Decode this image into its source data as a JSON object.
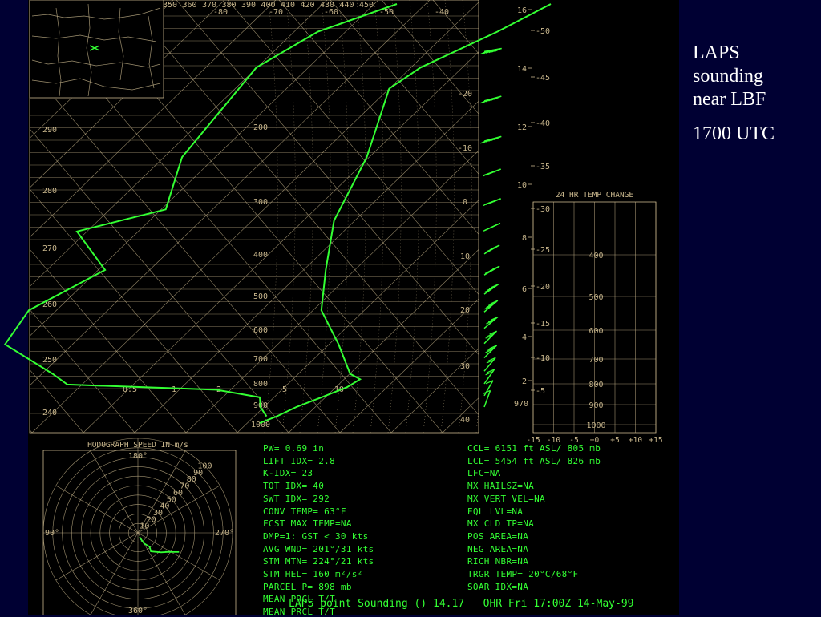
{
  "caption": {
    "title_lines": [
      "LAPS",
      "sounding",
      "near LBF"
    ],
    "time": "1700 UTC"
  },
  "colors": {
    "slide_bg": "#000033",
    "chart_bg": "#000000",
    "grid": "#c8b68c",
    "data": "#33ff33",
    "label": "#ffffff"
  },
  "chart_data": [
    {
      "type": "line",
      "name": "skewt-log-p",
      "pressure_levels_mb": [
        200,
        300,
        400,
        500,
        600,
        700,
        800,
        900,
        1000
      ],
      "theta_labels_k": [
        250,
        260,
        270,
        280,
        290
      ],
      "top_theta_labels_k": [
        350,
        360,
        370,
        380,
        390,
        400,
        410,
        420,
        430,
        440,
        450
      ],
      "top_temp_labels_c": [
        -80,
        -70,
        -60,
        -50,
        -40
      ],
      "side_temp_labels_c": [
        -20,
        -10,
        0,
        10,
        20,
        30,
        40
      ],
      "mixing_ratio_labels": [
        "0.5",
        "1",
        "2",
        "5",
        "10"
      ],
      "height_labels_kft": [
        16,
        14,
        12,
        10,
        8,
        6,
        4,
        2
      ],
      "height_temp_labels_c": [
        -50,
        -45,
        -40,
        -35,
        -30,
        -25,
        -20,
        -15,
        -10,
        -5
      ],
      "surface_pressure_label": "970",
      "series": [
        {
          "role": "temperature",
          "points": [
            [
              -15,
              1000
            ],
            [
              -13,
              970
            ],
            [
              -11,
              930
            ],
            [
              -8,
              890
            ],
            [
              -5,
              850
            ],
            [
              -4,
              820
            ],
            [
              -7,
              800
            ],
            [
              -15,
              700
            ],
            [
              -25,
              600
            ],
            [
              -32,
              500
            ],
            [
              -40,
              400
            ],
            [
              -46,
              300
            ],
            [
              -55,
              220
            ],
            [
              -53,
              200
            ],
            [
              -45,
              170
            ],
            [
              -40,
              150
            ]
          ]
        },
        {
          "role": "dewpoint",
          "points": [
            [
              -15,
              970
            ],
            [
              -18,
              930
            ],
            [
              -20,
              890
            ],
            [
              -30,
              860
            ],
            [
              -60,
              840
            ],
            [
              -65,
              800
            ],
            [
              -80,
              700
            ],
            [
              -82,
              600
            ],
            [
              -75,
              500
            ],
            [
              -88,
              420
            ],
            [
              -75,
              380
            ],
            [
              -82,
              300
            ],
            [
              -85,
              200
            ],
            [
              -80,
              170
            ],
            [
              -70,
              150
            ]
          ]
        }
      ],
      "wind_barbs_kts": [
        {
          "level": 1000,
          "speed": 5,
          "dir": 200
        },
        {
          "level": 950,
          "speed": 10,
          "dir": 210
        },
        {
          "level": 900,
          "speed": 15,
          "dir": 215
        },
        {
          "level": 850,
          "speed": 20,
          "dir": 220
        },
        {
          "level": 800,
          "speed": 25,
          "dir": 225
        },
        {
          "level": 750,
          "speed": 30,
          "dir": 225
        },
        {
          "level": 700,
          "speed": 30,
          "dir": 230
        },
        {
          "level": 650,
          "speed": 35,
          "dir": 230
        },
        {
          "level": 600,
          "speed": 35,
          "dir": 235
        },
        {
          "level": 550,
          "speed": 40,
          "dir": 240
        },
        {
          "level": 500,
          "speed": 40,
          "dir": 240
        },
        {
          "level": 450,
          "speed": 45,
          "dir": 245
        },
        {
          "level": 400,
          "speed": 45,
          "dir": 250
        },
        {
          "level": 350,
          "speed": 50,
          "dir": 250
        },
        {
          "level": 300,
          "speed": 55,
          "dir": 255
        },
        {
          "level": 250,
          "speed": 60,
          "dir": 255
        },
        {
          "level": 200,
          "speed": 65,
          "dir": 260
        }
      ]
    },
    {
      "type": "line",
      "name": "24-hr-temp-change",
      "title": "24 HR TEMP CHANGE",
      "x_tick_labels": [
        "-15",
        "-10",
        "-5",
        "+0",
        "+5",
        "+10",
        "+15"
      ],
      "xlim": [
        -15,
        15
      ],
      "pressure_labels_mb": [
        400,
        500,
        600,
        700,
        800,
        900,
        1000
      ],
      "series": []
    },
    {
      "type": "scatter",
      "name": "hodograph",
      "title": "HODOGRAPH SPEED IN m/s",
      "direction_labels": [
        "180°",
        "270°",
        "360°",
        "90°"
      ],
      "ring_labels_ms": [
        10,
        20,
        30,
        40,
        50,
        60,
        70,
        80,
        90,
        100
      ],
      "points_ms_dir": [
        [
          3,
          200
        ],
        [
          8,
          210
        ],
        [
          12,
          220
        ],
        [
          15,
          215
        ],
        [
          20,
          230
        ],
        [
          25,
          240
        ],
        [
          22,
          235
        ],
        [
          30,
          245
        ]
      ]
    }
  ],
  "indices_left": [
    "PW= 0.69 in",
    "LIFT IDX= 2.8",
    "K-IDX= 23",
    "TOT IDX= 40",
    "SWT IDX= 292",
    "CONV TEMP= 63°F",
    "FCST MAX TEMP=NA",
    "DMP=1: GST < 30 kts",
    "AVG WND= 201°/31 kts",
    "STM MTN= 224°/21 kts",
    "STM HEL= 160 m²/s²",
    "PARCEL P= 898 mb",
    "MEAN PRCL T/T",
    "MEAN PRCL T/T"
  ],
  "indices_right": [
    "CCL= 6151 ft ASL/ 805 mb",
    "LCL= 5454 ft ASL/ 826 mb",
    "LFC=NA",
    "MX HAILSZ=NA",
    "MX VERT VEL=NA",
    "EQL LVL=NA",
    "MX CLD TP=NA",
    "POS AREA=NA",
    "NEG AREA=NA",
    "RICH NBR=NA",
    "TRGR TEMP= 20°C/68°F",
    "SOAR IDX=NA"
  ],
  "footer": "LAPS point Sounding () 14.17   OHR Fri 17:00Z 14-May-99"
}
